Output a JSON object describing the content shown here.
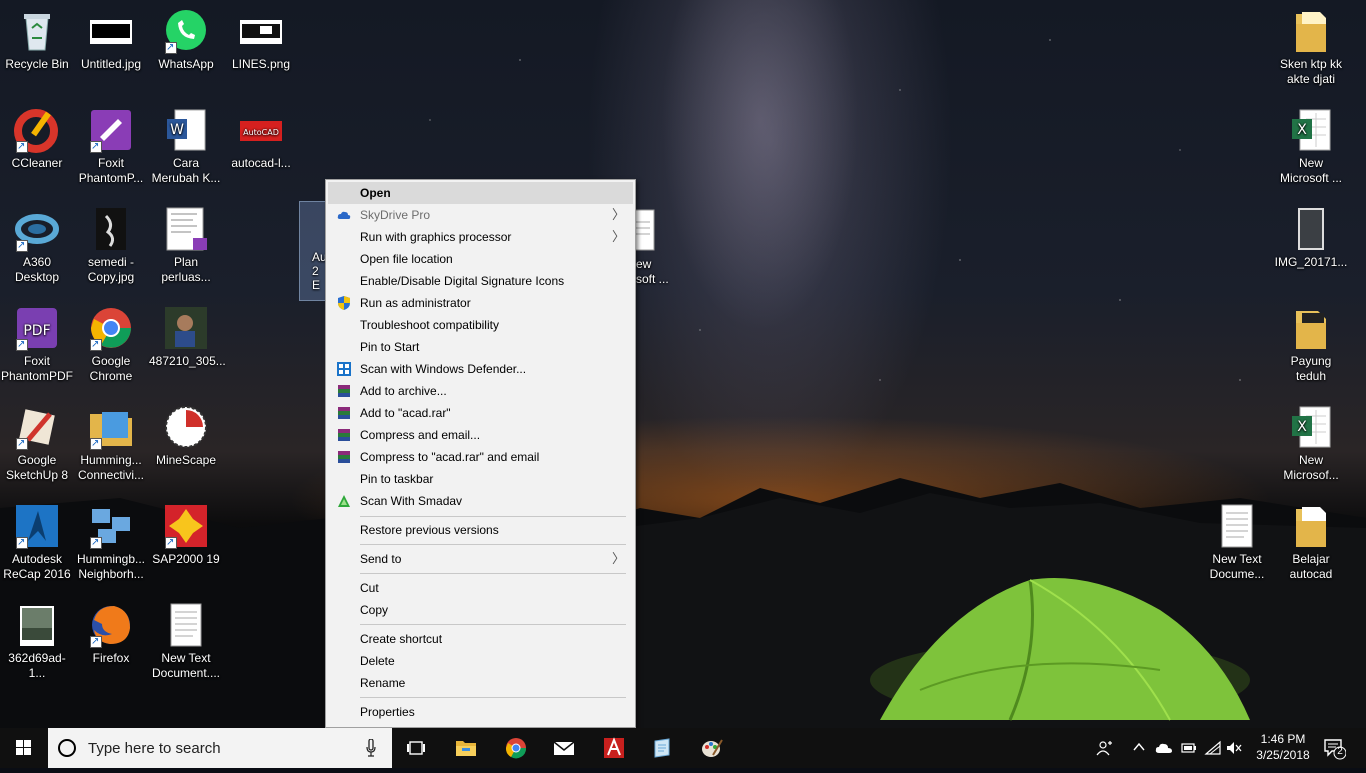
{
  "desktop": {
    "icons": [
      {
        "label": "Recycle Bin"
      },
      {
        "label": "Untitled.jpg"
      },
      {
        "label": "WhatsApp"
      },
      {
        "label": "LINES.png"
      },
      {
        "label": "CCleaner"
      },
      {
        "label": "Foxit\nPhantomP..."
      },
      {
        "label": "Cara\nMerubah K..."
      },
      {
        "label": "autocad-l..."
      },
      {
        "label": "A360\nDesktop"
      },
      {
        "label": "semedi -\nCopy.jpg"
      },
      {
        "label": "Plan\nperluas..."
      },
      {
        "label": "Foxit\nPhantomPDF"
      },
      {
        "label": "Google\nChrome"
      },
      {
        "label": "487210_305..."
      },
      {
        "label": "Google\nSketchUp 8"
      },
      {
        "label": "Humming...\nConnectivi..."
      },
      {
        "label": "MineScape"
      },
      {
        "label": "Autodesk\nReCap 2016"
      },
      {
        "label": "Hummingb...\nNeighborh..."
      },
      {
        "label": "SAP2000 19"
      },
      {
        "label": "362d69ad-1..."
      },
      {
        "label": "Firefox"
      },
      {
        "label": "New Text\nDocument...."
      },
      {
        "label": "Sken ktp kk\nakte djati"
      },
      {
        "label": "New\nMicrosoft ..."
      },
      {
        "label": "IMG_20171..."
      },
      {
        "label": "Payung\nteduh"
      },
      {
        "label": "New\nMicrosof..."
      },
      {
        "label": "New Text\nDocume..."
      },
      {
        "label": "Belajar\nautocad"
      },
      {
        "label": "Au\n2\nE"
      },
      {
        "label": "ew\nsoft ..."
      }
    ]
  },
  "context_menu": {
    "items": [
      {
        "label": "Open"
      },
      {
        "label": "SkyDrive Pro"
      },
      {
        "label": "Run with graphics processor"
      },
      {
        "label": "Open file location"
      },
      {
        "label": "Enable/Disable Digital Signature Icons"
      },
      {
        "label": "Run as administrator"
      },
      {
        "label": "Troubleshoot compatibility"
      },
      {
        "label": "Pin to Start"
      },
      {
        "label": "Scan with Windows Defender..."
      },
      {
        "label": "Add to archive..."
      },
      {
        "label": "Add to \"acad.rar\""
      },
      {
        "label": "Compress and email..."
      },
      {
        "label": "Compress to \"acad.rar\" and email"
      },
      {
        "label": "Pin to taskbar"
      },
      {
        "label": "Scan With Smadav"
      },
      {
        "label": "Restore previous versions"
      },
      {
        "label": "Send to"
      },
      {
        "label": "Cut"
      },
      {
        "label": "Copy"
      },
      {
        "label": "Create shortcut"
      },
      {
        "label": "Delete"
      },
      {
        "label": "Rename"
      },
      {
        "label": "Properties"
      }
    ]
  },
  "taskbar": {
    "search_placeholder": "Type here to search",
    "time": "1:46 PM",
    "date": "3/25/2018",
    "notification_count": "2"
  },
  "colors": {
    "menu_bg": "#f2f2f2",
    "menu_hover": "#dadada",
    "taskbar_bg": "#101010",
    "search_bg": "#f3f3f3"
  }
}
